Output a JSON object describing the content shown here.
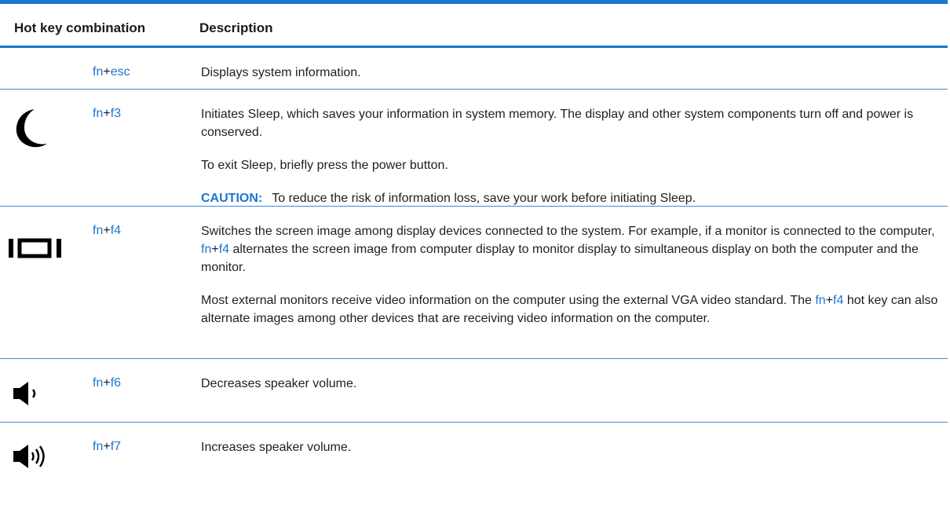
{
  "header": {
    "col_combination": "Hot key combination",
    "col_description": "Description"
  },
  "rows": [
    {
      "icon": "none",
      "key1": "fn",
      "plus": "+",
      "key2": "esc",
      "desc": [
        "Displays system information."
      ]
    },
    {
      "icon": "sleep-moon-icon",
      "key1": "fn",
      "plus": "+",
      "key2": "f3",
      "desc": [
        "Initiates Sleep, which saves your information in system memory. The display and other system components turn off and power is conserved.",
        "To exit Sleep, briefly press the power button."
      ],
      "caution_label": "CAUTION:",
      "caution_text": "To reduce the risk of information loss, save your work before initiating Sleep."
    },
    {
      "icon": "switch-display-icon",
      "key1": "fn",
      "plus": "+",
      "key2": "f4",
      "desc_p1_a": "Switches the screen image among display devices connected to the system. For example, if a monitor is connected to the computer, ",
      "desc_p1_k1": "fn",
      "desc_p1_plus": "+",
      "desc_p1_k2": "f4",
      "desc_p1_b": " alternates the screen image from computer display to monitor display to simultaneous display on both the computer and the monitor.",
      "desc_p2_a": "Most external monitors receive video information on the computer using the external VGA video standard. The ",
      "desc_p2_k1": "fn",
      "desc_p2_plus": "+",
      "desc_p2_k2": "f4",
      "desc_p2_b": " hot key can also alternate images among other devices that are receiving video information on the computer."
    },
    {
      "icon": "volume-down-icon",
      "key1": "fn",
      "plus": "+",
      "key2": "f6",
      "desc": [
        "Decreases speaker volume."
      ]
    },
    {
      "icon": "volume-up-icon",
      "key1": "fn",
      "plus": "+",
      "key2": "f7",
      "desc": [
        "Increases speaker volume."
      ]
    }
  ],
  "colors": {
    "accent": "#1b75d3",
    "text": "#1f1f1f",
    "icon": "#000000"
  }
}
